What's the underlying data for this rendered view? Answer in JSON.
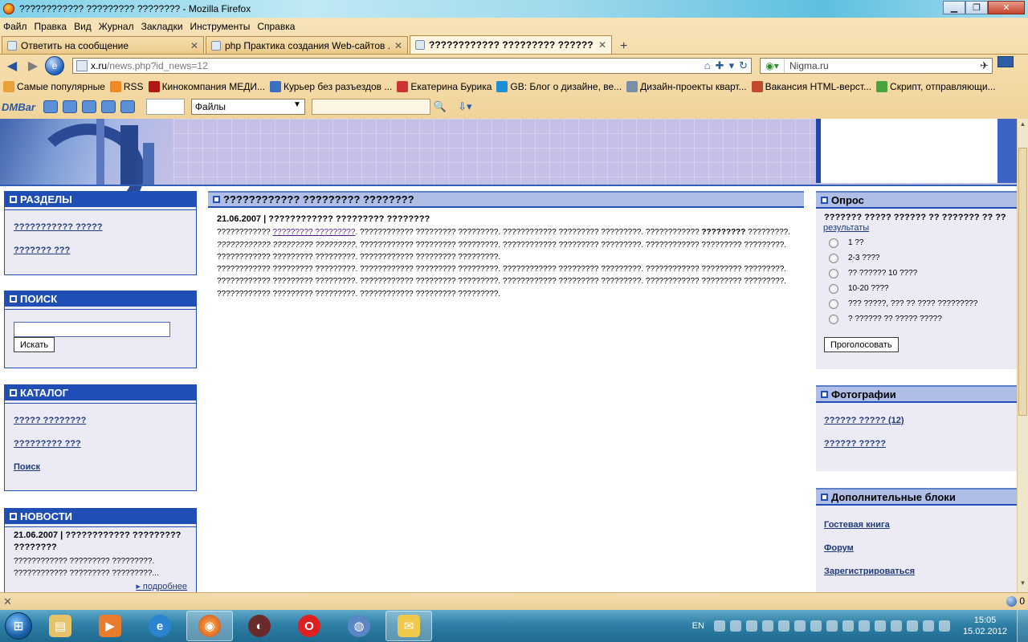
{
  "window": {
    "title": "???????????? ????????? ???????? - Mozilla Firefox"
  },
  "menu": [
    "Файл",
    "Правка",
    "Вид",
    "Журнал",
    "Закладки",
    "Инструменты",
    "Справка"
  ],
  "tabs": [
    {
      "label": "Ответить на сообщение",
      "active": false
    },
    {
      "label": "php Практика создания Web-сайтов ...",
      "active": false
    },
    {
      "label": "???????????? ????????? ????????",
      "active": true
    }
  ],
  "nav": {
    "url_host": "x.ru",
    "url_path": "/news.php?id_news=12",
    "search_value": "Nigma.ru"
  },
  "bookmarks": [
    {
      "label": "Самые популярные",
      "color": "#e8a23a"
    },
    {
      "label": "RSS",
      "color": "#f08a24"
    },
    {
      "label": "Кинокомпания МЕДИ...",
      "color": "#b01818"
    },
    {
      "label": "Курьер без разъездов ...",
      "color": "#3a6fc2"
    },
    {
      "label": "Екатерина Бурика",
      "color": "#c33"
    },
    {
      "label": "GB: Блог о дизайне, ве...",
      "color": "#1e8fd6"
    },
    {
      "label": "Дизайн-проекты кварт...",
      "color": "#7a8ea8"
    },
    {
      "label": "Вакансия HTML-верст...",
      "color": "#c4482a"
    },
    {
      "label": "Скрипт, отправляющи...",
      "color": "#4aa33a"
    }
  ],
  "dmbar": {
    "brand": "DMBar",
    "files_label": "Файлы"
  },
  "left": {
    "sections": {
      "title": "РАЗДЕЛЫ",
      "links": [
        "??????????? ?????",
        "??????? ???"
      ]
    },
    "search": {
      "title": "ПОИСК",
      "button": "Искать"
    },
    "catalog": {
      "title": "КАТАЛОГ",
      "links": [
        "????? ????????",
        "????????? ???",
        "Поиск"
      ]
    },
    "news": {
      "title": "НОВОСТИ",
      "item_title": "21.06.2007 | ???????????? ????????? ????????",
      "item_text": "???????????? ????????? ?????????. ???????????? ????????? ?????????...",
      "more": "подробнее"
    }
  },
  "center": {
    "header": "???????????? ????????? ????????",
    "news_title": "21.06.2007 | ???????????? ????????? ????????",
    "p1_a": "???????????? ",
    "p1_link": "????????? ?????????",
    "p1_b": ". ???????????? ????????? ?????????. ???????????? ????????? ?????????. ???????????? ",
    "p1_bold": "?????????",
    "p1_c": " ?????????. ",
    "p1_italic": "???????????? ????????? ?????????.",
    "p1_d": " ???????????? ????????? ?????????. ???????????? ????????? ?????????. ???????????? ????????? ?????????. ???????????? ????????? ?????????. ???????????? ????????? ?????????.",
    "p2": "???????????? ????????? ?????????. ???????????? ????????? ?????????. ???????????? ????????? ?????????. ???????????? ????????? ?????????. ???????????? ????????? ?????????. ???????????? ????????? ?????????. ???????????? ????????? ?????????. ???????????? ????????? ?????????. ???????????? ????????? ?????????. ???????????? ????????? ?????????."
  },
  "right": {
    "poll": {
      "title": "Опрос",
      "question": "??????? ????? ?????? ?? ??????? ?? ??",
      "results": "результаты",
      "options": [
        "1 ??",
        "2-3 ????",
        "?? ?????? 10 ????",
        "10-20 ????",
        "??? ?????, ??? ?? ???? ?????????",
        "? ?????? ?? ????? ?????"
      ],
      "vote": "Проголосовать"
    },
    "photos": {
      "title": "Фотографии",
      "links": [
        "?????? ????? (12)",
        "?????? ?????"
      ]
    },
    "extra": {
      "title": "Дополнительные блоки",
      "links": [
        "Гостевая книга",
        "Форум",
        "Зарегистрироваться"
      ]
    }
  },
  "statusbar": {
    "close": "✕",
    "counter": "0"
  },
  "taskbar": {
    "lang": "EN",
    "time": "15:05",
    "date": "15.02.2012"
  }
}
